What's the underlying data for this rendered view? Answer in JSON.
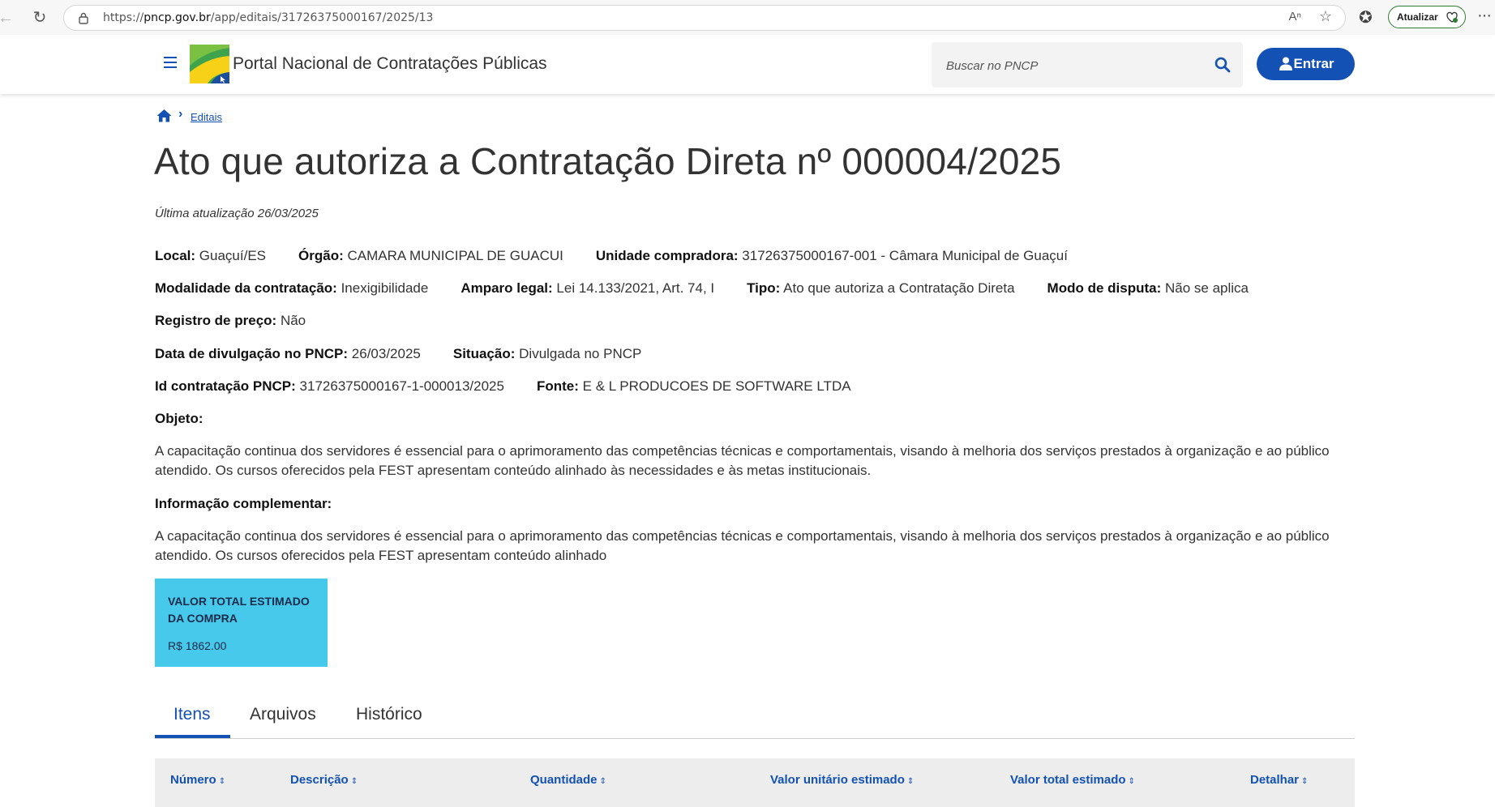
{
  "browser": {
    "url_prefix": "https://",
    "url_host": "pncp.gov.br",
    "url_path": "/app/editais/31726375000167/2025/13",
    "update_label": "Atualizar"
  },
  "header": {
    "portal_title": "Portal Nacional de Contratações Públicas",
    "search_placeholder": "Buscar no PNCP",
    "login_label": "Entrar"
  },
  "breadcrumb": {
    "link": "Editais"
  },
  "page": {
    "title": "Ato que autoriza a Contratação Direta nº 000004/2025",
    "updated": "Última atualização 26/03/2025"
  },
  "details": {
    "local_k": "Local:",
    "local_v": "Guaçuí/ES",
    "orgao_k": "Órgão:",
    "orgao_v": "CAMARA MUNICIPAL DE GUACUI",
    "unidade_k": "Unidade compradora:",
    "unidade_v": "31726375000167-001 - Câmara Municipal de Guaçuí",
    "modalidade_k": "Modalidade da contratação:",
    "modalidade_v": "Inexigibilidade",
    "amparo_k": "Amparo legal:",
    "amparo_v": "Lei 14.133/2021, Art. 74, I",
    "tipo_k": "Tipo:",
    "tipo_v": "Ato que autoriza a Contratação Direta",
    "modo_k": "Modo de disputa:",
    "modo_v": "Não se aplica",
    "registro_k": "Registro de preço:",
    "registro_v": "Não",
    "data_k": "Data de divulgação no PNCP:",
    "data_v": "26/03/2025",
    "situacao_k": "Situação:",
    "situacao_v": "Divulgada no PNCP",
    "id_k": "Id contratação PNCP:",
    "id_v": "31726375000167-1-000013/2025",
    "fonte_k": "Fonte:",
    "fonte_v": "E & L PRODUCOES DE SOFTWARE LTDA"
  },
  "objeto": {
    "label": "Objeto:",
    "text": "A capacitação continua dos servidores é essencial para o aprimoramento das competências técnicas e comportamentais, visando à melhoria dos serviços prestados à organização e ao público atendido. Os cursos oferecidos pela FEST apresentam conteúdo alinhado às necessidades e às metas institucionais."
  },
  "complementar": {
    "label": "Informação complementar:",
    "text": "A capacitação continua dos servidores é essencial para o aprimoramento das competências técnicas e comportamentais, visando à melhoria dos serviços prestados à organização e ao público atendido. Os cursos oferecidos pela FEST apresentam conteúdo alinhado"
  },
  "valor": {
    "title": "VALOR TOTAL ESTIMADO DA COMPRA",
    "value": "R$ 1862.00"
  },
  "tabs": [
    "Itens",
    "Arquivos",
    "Histórico"
  ],
  "table": {
    "columns": [
      "Número",
      "Descrição",
      "Quantidade",
      "Valor unitário estimado",
      "Valor total estimado",
      "Detalhar"
    ]
  },
  "colors": {
    "primary": "#1351b4",
    "card": "#46c9ea"
  }
}
